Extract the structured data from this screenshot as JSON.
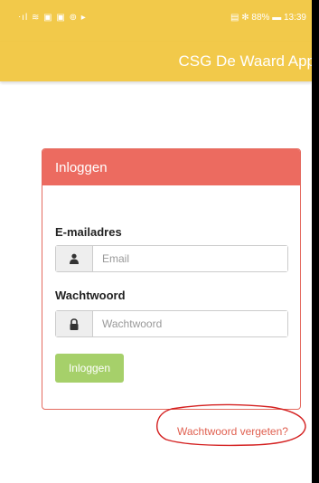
{
  "status": {
    "left_icons": "⋅ıl ≋ ▣ ▣ ⊚ ▸",
    "right_text": "▤ ✻ 88% ▬ 13:39"
  },
  "app": {
    "title": "CSG De Waard App"
  },
  "login": {
    "header": "Inloggen",
    "email_label": "E-mailadres",
    "email_placeholder": "Email",
    "password_label": "Wachtwoord",
    "password_placeholder": "Wachtwoord",
    "submit_label": "Inloggen"
  },
  "forgot_link": "Wachtwoord vergeten?",
  "colors": {
    "header": "#f2c94a",
    "card_header": "#ec6b60",
    "button": "#a6d06a",
    "link": "#e06050",
    "annotation": "#d42020"
  },
  "icons": {
    "email": "user-icon",
    "password": "lock-icon"
  }
}
